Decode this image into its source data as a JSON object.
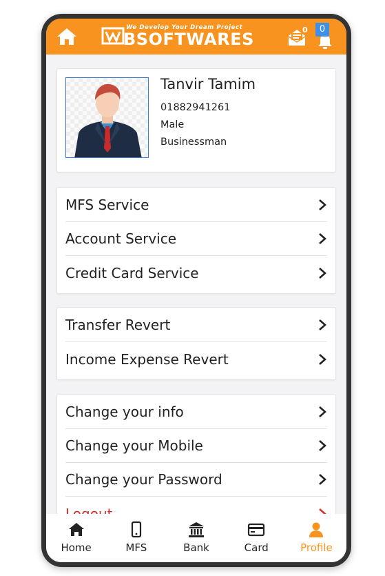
{
  "header": {
    "logo_tagline": "We Develop Your Dream Project",
    "logo_text": "BSOFTWARES",
    "mail_count": "0",
    "notification_count": "0",
    "accent_color": "#f7931e"
  },
  "profile": {
    "name": "Tanvir Tamim",
    "phone": "01882941261",
    "gender": "Male",
    "occupation": "Businessman"
  },
  "menu_groups": [
    [
      "MFS Service",
      "Account Service",
      "Credit Card Service"
    ],
    [
      "Transfer Revert",
      "Income Expense Revert"
    ],
    [
      "Change your info",
      "Change your Mobile",
      "Change your Password",
      "Logout"
    ]
  ],
  "bottom_nav": [
    {
      "label": "Home",
      "icon": "home-icon"
    },
    {
      "label": "MFS",
      "icon": "mobile-icon"
    },
    {
      "label": "Bank",
      "icon": "bank-icon"
    },
    {
      "label": "Card",
      "icon": "credit-card-icon"
    },
    {
      "label": "Profile",
      "icon": "user-icon",
      "active": true
    }
  ]
}
